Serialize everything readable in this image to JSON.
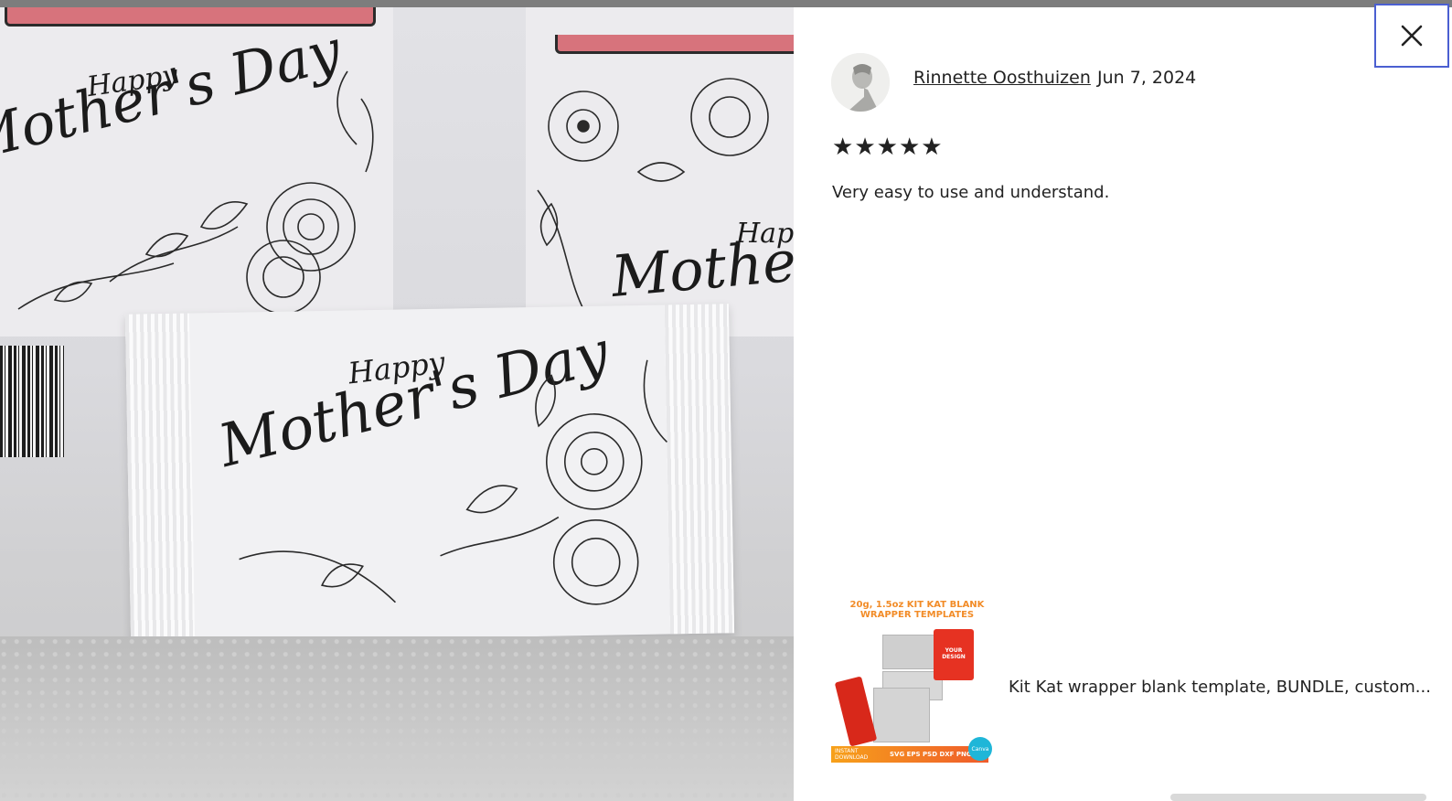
{
  "modal": {
    "close_label": "×",
    "close_icon": "close-icon"
  },
  "photo": {
    "wrapper_text_happy": "Happy",
    "wrapper_text_main": "Mother's Day"
  },
  "review": {
    "reviewer_name": "Rinnette Oosthuizen",
    "date": "Jun 7, 2024",
    "rating": 5,
    "stars": [
      "★",
      "★",
      "★",
      "★",
      "★"
    ],
    "text": "Very easy to use and understand."
  },
  "product": {
    "thumb_title": "20g, 1.5oz KIT KAT BLANK WRAPPER TEMPLATES",
    "thumb_badge": "YOUR DESIGN",
    "thumb_formats": "SVG EPS PSD DXF PNG",
    "thumb_download": "INSTANT DOWNLOAD",
    "thumb_canva": "Canva",
    "title": "Kit Kat wrapper blank template, BUNDLE, custom..."
  },
  "colors": {
    "accent_focus": "#4b5fd1",
    "text": "#222222",
    "thumb_orange": "#f28c28",
    "thumb_red": "#e63222"
  }
}
